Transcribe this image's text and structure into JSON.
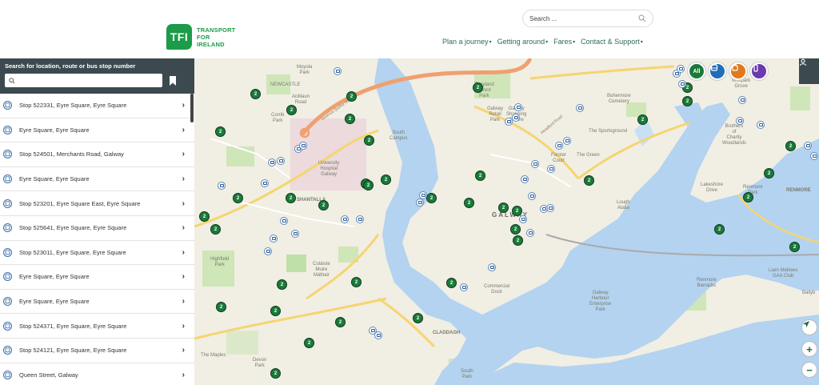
{
  "header": {
    "logo_mark": "TFI",
    "logo_lines": [
      "TRANSPORT",
      "FOR",
      "IRELAND"
    ],
    "search_placeholder": "Search ...",
    "nav": [
      "Plan a journey",
      "Getting around",
      "Fares",
      "Contact & Support"
    ]
  },
  "sidebar": {
    "title": "Search for location, route or bus stop number",
    "search_value": "",
    "results": [
      "Stop 522331, Eyre Square, Eyre Square",
      "Eyre Square, Eyre Square",
      "Stop 524501, Merchants Road, Galway",
      "Eyre Square, Eyre Square",
      "Stop 523201, Eyre Square East, Eyre Square",
      "Stop 525641, Eyre Square, Eyre Square",
      "Stop 523011, Eyre Square, Eyre Square",
      "Eyre Square, Eyre Square",
      "Eyre Square, Eyre Square",
      "Stop 524371, Eyre Square, Eyre Square",
      "Stop 524121, Eyre Square, Eyre Square",
      "Queen Street, Galway"
    ]
  },
  "map": {
    "mode_buttons": [
      {
        "label": "All",
        "color": "#1b7a3a"
      },
      {
        "icon": "bus-icon",
        "color": "#1f6fb8"
      },
      {
        "icon": "tram-icon",
        "color": "#e07a1a"
      },
      {
        "icon": "phone-icon",
        "color": "#6a3ab0"
      }
    ],
    "cluster_count": "2",
    "city_label": "GALWAY",
    "labels": {
      "newcastle": "NEWCASTLE",
      "moyola": "Moyola\nPark",
      "ardilaun": "Ardilaun\nRoad",
      "corrib": "Corrib\nPark",
      "hospital": "University\nHospital\nGalway",
      "shantalla": "SHANTALLA",
      "highfield": "Highfield\nPark",
      "colaiste": "Coláiste\nMuire\nMáthair",
      "maples": "The Maples",
      "devon": "Devon\nPark",
      "claddagh": "CLADDAGH",
      "southpark": "South\nPark",
      "commercial": "Commercial\nDock",
      "harbour": "Galway\nHarbour\nEnterprise\nPark",
      "lough": "Lough\nAtalia",
      "bohermore": "Bohermore\nCemetery",
      "renmore": "RENMORE",
      "lakeshore": "Lakeshore\nDrive",
      "renmore_park": "Renmore\nPark",
      "liam": "Liam Mellows\nGAA Club",
      "terryland": "Terryland\nForest\nPark",
      "retail": "Galway\nRetail\nPark",
      "shopping": "Galway\nShopping\nCentre",
      "southcampus": "South\nCampus",
      "forster": "Forster\nCourt",
      "sportsground": "The Sportsground",
      "thegreen": "The Green",
      "wellpark": "Wellpark\nGrove",
      "renmore_barracks": "Renmore\nBarracks",
      "brothers": "Brothers\nof\nCharity\nWoodlands",
      "seamus": "Seamus Quirke Road",
      "headford": "Headford Road",
      "ballyb": "Ballyb"
    }
  }
}
